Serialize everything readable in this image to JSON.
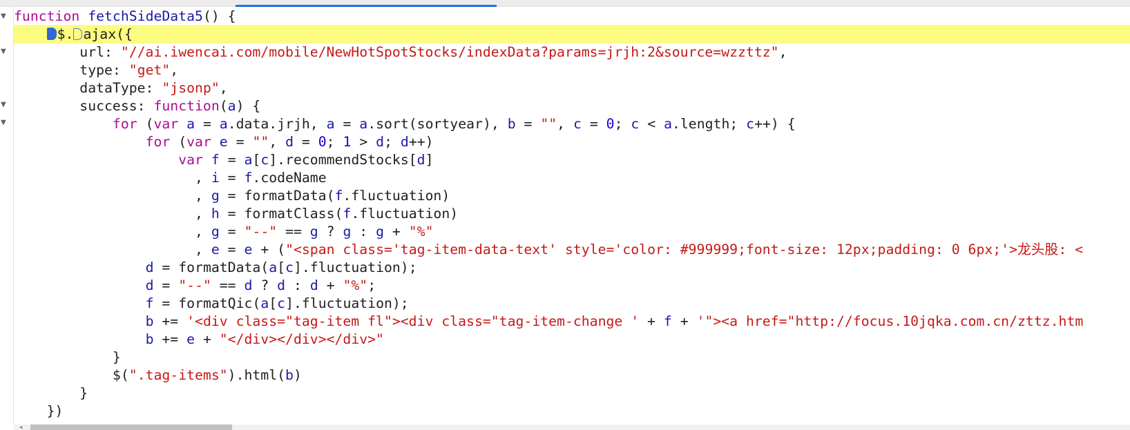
{
  "editor": {
    "line1": {
      "kw": "function",
      "fname": "fetchSideData5",
      "rest": "() {"
    },
    "line2": {
      "dollar": "$.",
      "call": "ajax({"
    },
    "line3": {
      "key": "url: ",
      "str": "\"//ai.iwencai.com/mobile/NewHotSpotStocks/indexData?params=jrjh:2&source=wzzttz\"",
      "tail": ","
    },
    "line4": {
      "key": "type: ",
      "str": "\"get\"",
      "tail": ","
    },
    "line5": {
      "key": "dataType: ",
      "str": "\"jsonp\"",
      "tail": ","
    },
    "line6": {
      "key": "success: ",
      "kw": "function",
      "p1": "(",
      "arg": "a",
      "p2": ") {"
    },
    "line7": {
      "kw_for": "for",
      "t1": " (",
      "kw_var": "var",
      "t2": " ",
      "a1": "a",
      "t3": " = ",
      "a2": "a",
      "t4": ".data.jrjh, ",
      "a3": "a",
      "t5": " = ",
      "a4": "a",
      "t6": ".sort(sortyear), ",
      "b1": "b",
      "t7": " = ",
      "s1": "\"\"",
      "t8": ", ",
      "c1": "c",
      "t9": " = ",
      "n0": "0",
      "t10": "; ",
      "c2": "c",
      "t11": " < ",
      "a5": "a",
      "t12": ".length; ",
      "c3": "c",
      "t13": "++) {"
    },
    "line8": {
      "kw_for": "for",
      "t1": " (",
      "kw_var": "var",
      "t2": " ",
      "e1": "e",
      "t3": " = ",
      "s1": "\"\"",
      "t4": ", ",
      "d1": "d",
      "t5": " = ",
      "n0": "0",
      "t6": "; ",
      "n1": "1",
      "t7": " > ",
      "d2": "d",
      "t8": "; ",
      "d3": "d",
      "t9": "++)"
    },
    "line9": {
      "kw_var": "var",
      "t1": " ",
      "f1": "f",
      "t2": " = ",
      "a1": "a",
      "t3": "[",
      "c1": "c",
      "t4": "].recommendStocks[",
      "d1": "d",
      "t5": "]"
    },
    "line10": {
      "t1": ", ",
      "i1": "i",
      "t2": " = ",
      "f1": "f",
      "t3": ".codeName"
    },
    "line11": {
      "t1": ", ",
      "g1": "g",
      "t2": " = formatData(",
      "f1": "f",
      "t3": ".fluctuation)"
    },
    "line12": {
      "t1": ", ",
      "h1": "h",
      "t2": " = formatClass(",
      "f1": "f",
      "t3": ".fluctuation)"
    },
    "line13": {
      "t1": ", ",
      "g1": "g",
      "t2": " = ",
      "s1": "\"--\"",
      "t3": " == ",
      "g2": "g",
      "t4": " ? ",
      "g3": "g",
      "t5": " : ",
      "g4": "g",
      "t6": " + ",
      "s2": "\"%\""
    },
    "line14": {
      "t1": ", ",
      "e1": "e",
      "t2": " = ",
      "e2": "e",
      "t3": " + (",
      "s1": "\"<span class='tag-item-data-text' style='color: #999999;font-size: 12px;padding: 0 6px;'>龙头股: <"
    },
    "line15": {
      "d1": "d",
      "t1": " = formatData(",
      "a1": "a",
      "t2": "[",
      "c1": "c",
      "t3": "].fluctuation);"
    },
    "line16": {
      "d1": "d",
      "t1": " = ",
      "s1": "\"--\"",
      "t2": " == ",
      "d2": "d",
      "t3": " ? ",
      "d3": "d",
      "t4": " : ",
      "d4": "d",
      "t5": " + ",
      "s2": "\"%\"",
      "t6": ";"
    },
    "line17": {
      "f1": "f",
      "t1": " = formatQic(",
      "a1": "a",
      "t2": "[",
      "c1": "c",
      "t3": "].fluctuation);"
    },
    "line18": {
      "b1": "b",
      "t1": " += ",
      "s1": "'<div class=\"tag-item fl\"><div class=\"tag-item-change '",
      "t2": " + ",
      "f1": "f",
      "t3": " + ",
      "s2": "'\"><a href=\"http://focus.10jqka.com.cn/zttz.htm"
    },
    "line19": {
      "b1": "b",
      "t1": " += ",
      "e1": "e",
      "t2": " + ",
      "s1": "\"</div></div></div>\""
    },
    "line20": {
      "t1": "}"
    },
    "line21": {
      "t1": "$(",
      "s1": "\".tag-items\"",
      "t2": ").html(",
      "b1": "b",
      "t3": ")"
    },
    "line22": {
      "t1": "}"
    },
    "line23": {
      "t1": "})"
    }
  },
  "gutter": {
    "fold_icon": "▼"
  },
  "scrollbar": {
    "left_arrow": "◀"
  }
}
